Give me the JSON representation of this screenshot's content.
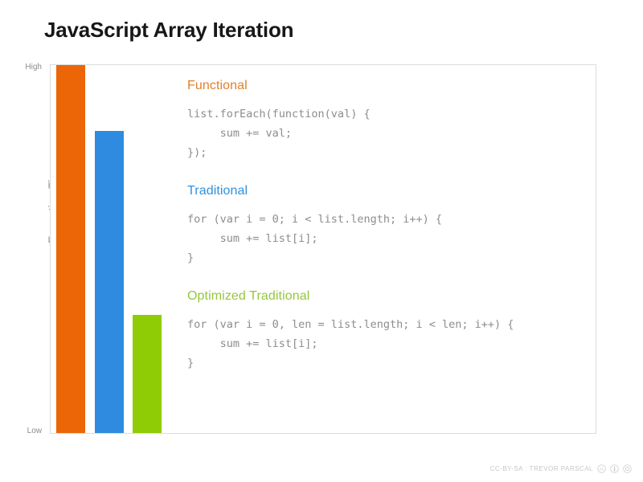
{
  "slide": {
    "title": "JavaScript Array Iteration"
  },
  "chart_data": {
    "type": "bar",
    "title": "JavaScript Array Iteration",
    "xlabel": "",
    "ylabel": "Execution Time",
    "ylim": [
      0,
      100
    ],
    "grid": false,
    "legend": "none",
    "tick_labels": [
      "High",
      "Low"
    ],
    "categories": [
      "Functional",
      "Traditional",
      "Optimized Traditional"
    ],
    "values": [
      100,
      82,
      32
    ],
    "colors": [
      "#EC6608",
      "#2E8BE0",
      "#8FCC05"
    ]
  },
  "axis": {
    "y_title": "Execution Time",
    "tick_high": "High",
    "tick_low": "Low"
  },
  "code_blocks": [
    {
      "heading": "Functional",
      "color": "#E0812B",
      "code": "list.forEach(function(val) {\n     sum += val;\n});"
    },
    {
      "heading": "Traditional",
      "color": "#3091DD",
      "code": "for (var i = 0; i < list.length; i++) {\n     sum += list[i];\n}"
    },
    {
      "heading": "Optimized Traditional",
      "color": "#94C73D",
      "code": "for (var i = 0, len = list.length; i < len; i++) {\n     sum += list[i];\n}"
    }
  ],
  "footer": {
    "attribution": "CC-BY-SA : TREVOR PARSCAL",
    "icons": [
      "creative-commons-icon",
      "attribution-icon",
      "share-alike-icon"
    ]
  }
}
